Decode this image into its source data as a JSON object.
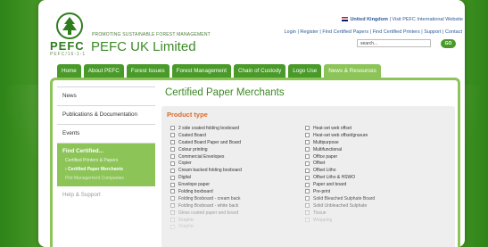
{
  "header": {
    "logo_text": "PEFC",
    "logo_subtext": "PEFC/16-1-1",
    "tagline": "PROMOTING SUSTAINABLE FOREST MANAGEMENT",
    "brand": "PEFC UK Limited",
    "locale": "United Kingdom",
    "intl_link": "Visit PEFC International Website",
    "links": [
      "Login",
      "Register",
      "Find Certified Papers",
      "Find Certified Printers",
      "Support",
      "Contact"
    ],
    "search_placeholder": "search...",
    "go_label": "GO",
    "colors": {
      "brand_green": "#3c8a26",
      "nav_green": "#4a9a2a",
      "accent_light_green": "#8dc458",
      "heading_orange": "#d86a2a"
    }
  },
  "nav": {
    "items": [
      "Home",
      "About PEFC",
      "Forest Issues",
      "Forest Management",
      "Chain of Custody",
      "Logo Use",
      "News & Resources"
    ],
    "active": "News & Resources"
  },
  "sidebar": {
    "news": "News",
    "publications": "Publications & Documentation",
    "events": "Events",
    "find_certified": "Find Certified...",
    "sub_printers": "Certified Printers & Papers",
    "sub_merchants": "› Certified Paper Merchants",
    "sub_plot": "Plot Management Companies",
    "help": "Help & Support"
  },
  "main": {
    "title": "Certified Paper Merchants",
    "section_title": "Product type",
    "left_column": [
      "2 side coated folding boxboard",
      "Coated Board",
      "Coated Board Paper and Board",
      "Colour printing",
      "Commercial Envelopes",
      "Copier",
      "Cream backed folding boxboard",
      "Digital",
      "Envelope paper",
      "Folding boxboard",
      "Folding Boxboard - cream back",
      "Folding Boxboard - white back",
      "Gloss coated paper and board",
      "Graphic",
      "Graphic"
    ],
    "right_column": [
      "Heat-set web offset",
      "Heat-set web offset/gravure",
      "Multipurpose",
      "Multifunctional",
      "Office paper",
      "Offset",
      "Offset Litho",
      "Offset Litho & HSWO",
      "Paper and board",
      "Pre-print",
      "Solid Bleached Sulphate Board",
      "Solid Unbleached Sulphate",
      "Tissue",
      "Wrapping"
    ]
  }
}
